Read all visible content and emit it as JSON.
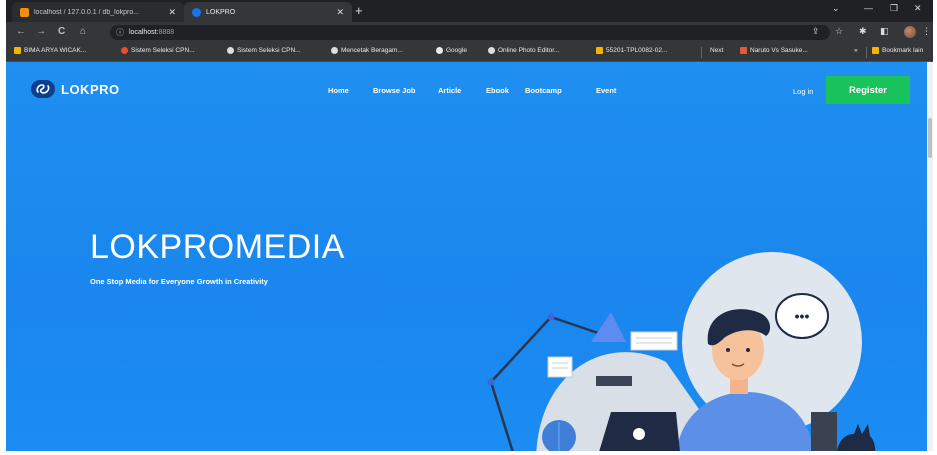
{
  "browser": {
    "tabs": [
      {
        "title": "localhost / 127.0.0.1 / db_lokpro...",
        "close": "✕"
      },
      {
        "title": "LOKPRO",
        "close": "✕"
      }
    ],
    "new_tab": "+",
    "window_controls": {
      "minimize": "—",
      "restore": "❐",
      "close": "✕"
    },
    "address": {
      "host": "localhost:",
      "port": "8888"
    },
    "bookmarks": [
      "BIMA ARYA WICAK...",
      "Sistem Seleksi CPN...",
      "Sistem Seleksi CPN...",
      "Mencetak Beragam...",
      "Google",
      "Online Photo Editor...",
      "55201-TPL0082-02...",
      "Next",
      "Naruto Vs Sasuke...",
      "»",
      "Bookmark lain"
    ]
  },
  "site": {
    "brand": "LOKPRO",
    "nav": [
      "Home",
      "Browse Job",
      "Article",
      "Ebook",
      "Bootcamp",
      "Event"
    ],
    "login": "Log in",
    "register": "Register",
    "hero": {
      "title": "LOKPROMEDIA",
      "subtitle": "One Stop Media for Everyone Growth in Creativity"
    },
    "speech_bubble": "•••"
  },
  "colors": {
    "hero_bg": "#1a86ee",
    "register_bg": "#19c35c",
    "logo_mark": "#0f3f8c"
  }
}
